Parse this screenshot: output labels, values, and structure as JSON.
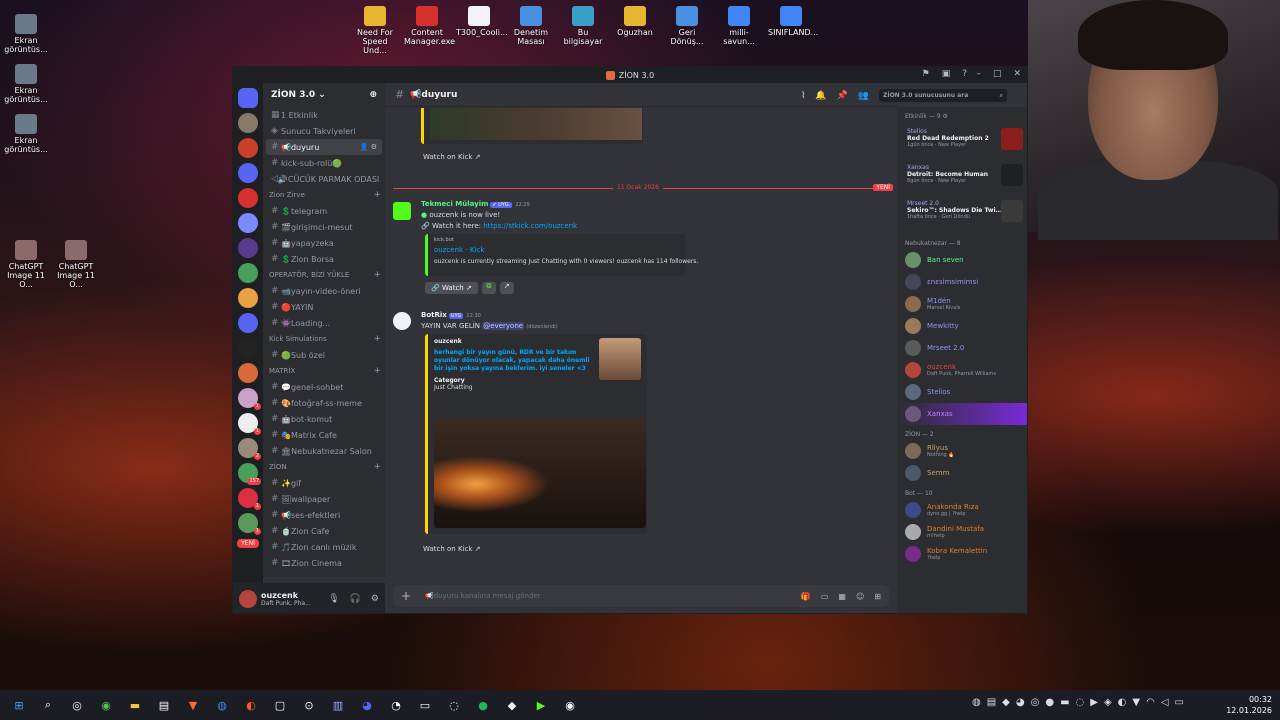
{
  "desktop": {
    "left_icons": [
      {
        "label": "Ekran görüntüs..."
      },
      {
        "label": "Ekran görüntüs..."
      },
      {
        "label": "Ekran görüntüs..."
      }
    ],
    "pair_icons": [
      {
        "label": "ChatGPT Image 11 O..."
      },
      {
        "label": "ChatGPT Image 11 O..."
      }
    ],
    "top_icons": [
      {
        "label": "Need For Speed Und..."
      },
      {
        "label": "Content Manager.exe"
      },
      {
        "label": "T300_Cooli..."
      },
      {
        "label": "Denetim Masası"
      },
      {
        "label": "Bu bilgisayar"
      },
      {
        "label": "Oguzhan"
      },
      {
        "label": "Geri Dönüş..."
      },
      {
        "label": "milli-savun..."
      },
      {
        "label": "SINIFLAND..."
      }
    ]
  },
  "window": {
    "title": "ZİON 3.0",
    "accent": "#5865f2"
  },
  "server": {
    "name": "ZİON 3.0",
    "top_items": [
      "1 Etkinlik",
      "Sunucu Takviyeleri"
    ],
    "channels_top": [
      {
        "label": "📢duyuru",
        "active": true
      },
      {
        "label": "kick-sub-rolü🟢"
      },
      {
        "label": "🔊CÜCÜK PARMAK ODASI"
      }
    ],
    "categories": [
      {
        "name": "Zion Zirve",
        "channels": [
          "💲telegram",
          "🎬girişimci-mesut",
          "🤖yapayzeka",
          "💲Zion Borsa"
        ]
      },
      {
        "name": "OPERATÖR, BİZİ YÜKLE",
        "channels": [
          "📹yayın-video-öneri",
          "🔴YAYIN",
          "👾Loading..."
        ]
      },
      {
        "name": "Kick Simulations",
        "channels": [
          "🟢Sub özel"
        ]
      },
      {
        "name": "MATRİX",
        "channels": [
          "💬genel-sohbet",
          "🎨fotoğraf-ss-meme",
          "🤖bot-komut",
          "🎭Matrix Cafe",
          "🏛Nebukatnezar Salon"
        ]
      },
      {
        "name": "ZİON",
        "channels": [
          "✨gif",
          "🖼wallpaper",
          "📢ses-efektleri",
          "🍵Zion Cafe",
          "🎵Zion canlı müzik",
          "🎞Zion Cinema"
        ]
      }
    ]
  },
  "user": {
    "name": "ouzcenk",
    "status": "Daft Punk, Pha..."
  },
  "chat": {
    "channel": "📢duyuru",
    "search_placeholder": "ZİON 3.0 sunucusunu ara",
    "watch_kick_1": "Watch on Kick",
    "divider_date": "11 Ocak 2026",
    "divider_new": "YENİ",
    "msg1": {
      "author": "Tekmeci Mülayim",
      "tag": "✔ UYG.",
      "time": "22:29",
      "line1": "ouzcenk is now live!",
      "line2_prefix": "Watch it here: ",
      "line2_link": "https://stkick.com/ouzcenk",
      "embed_provider": "kick.bot",
      "embed_title": "ouzcenk - Kick",
      "embed_desc": "ouzcenk is currently streaming Just Chatting with 0 viewers! ouzcenk has 114 followers.",
      "watch_btn": "Watch"
    },
    "msg2": {
      "author": "BotRix",
      "tag": "UYG",
      "time": "22:30",
      "text_prefix": "YAYIN VAR GELİN ",
      "mention": "@everyone",
      "edited": "(düzenlendi)",
      "embed_author": "ouzcenk",
      "embed_desc": "herhangi bir yayın günü, RDR ve bir takım oyunlar dönüyor olacak, yapacak daha önemli bir işin yoksa yayına beklerim. iyi seneler <3",
      "field_name": "Category",
      "field_value": "Just Chatting",
      "watch_kick": "Watch on Kick"
    },
    "composer_placeholder": "📢duyuru kanalına mesaj gönder"
  },
  "members": {
    "activity_header": "Etkinlik — 9",
    "activities": [
      {
        "user": "Stelios",
        "game": "Red Dead Redemption 2",
        "sub": "1gün önce  ·  New Player",
        "color": "#8b1e1e"
      },
      {
        "user": "Xanxas",
        "game": "Detroit: Become Human",
        "sub": "6gün önce  ·  New Player",
        "color": "#1e1f22"
      },
      {
        "user": "Mrseet 2.0",
        "game": "Sekiro™: Shadows Die Twi...",
        "sub": "1hafta önce  ·  Geri Döndü",
        "color": "#3a3a3a"
      }
    ],
    "groups": [
      {
        "name": "Nebukatnezar — 8",
        "members": [
          {
            "name": "Ban seven",
            "sub": "",
            "color": "#57f287",
            "av": "#6a8f6a"
          },
          {
            "name": "ɛnɛsimsimimsi",
            "sub": "",
            "color": "#8f95f5",
            "av": "#44475a"
          },
          {
            "name": "M1dén",
            "sub": "Marvel Rivals",
            "color": "#8f95f5",
            "av": "#8a6a4a"
          },
          {
            "name": "Mewkitty",
            "sub": "",
            "color": "#8f95f5",
            "av": "#9a7a5a"
          },
          {
            "name": "Mrseet 2.0",
            "sub": "",
            "color": "#8f95f5",
            "av": "#5a5a5a"
          },
          {
            "name": "ouzcenk",
            "sub": "Daft Punk, Pharrell Williams",
            "color": "#f23f43",
            "av": "#b4463c"
          },
          {
            "name": "Stelios",
            "sub": "",
            "color": "#8f95f5",
            "av": "#5a6a7a"
          },
          {
            "name": "Xanxas",
            "sub": "",
            "color": "#c77dff",
            "av": "#6a5a7a"
          }
        ]
      },
      {
        "name": "ZİON — 2",
        "members": [
          {
            "name": "Rllyus",
            "sub": "Nothing 🔥",
            "color": "#c9a26a",
            "av": "#7a6a5a"
          },
          {
            "name": "Semm",
            "sub": "",
            "color": "#c9a26a",
            "av": "#4a5a6a"
          }
        ]
      },
      {
        "name": "Bot — 10",
        "members": [
          {
            "name": "Anakonda Rıza",
            "sub": "dyno.gg | ?help",
            "color": "#e67e22",
            "av": "#3a4a8a"
          },
          {
            "name": "Dandini Mustafa",
            "sub": "m!help",
            "color": "#e67e22",
            "av": "#aaa"
          },
          {
            "name": "Kobra Kemalettin",
            "sub": "?help",
            "color": "#e67e22",
            "av": "#7a2a8a"
          }
        ]
      }
    ]
  },
  "guild_badges": [
    "1",
    "1",
    "2",
    "157",
    "1",
    "1"
  ],
  "guild_new": "YENİ",
  "taskbar": {
    "time": "00:32",
    "date": "12.01.2026"
  }
}
